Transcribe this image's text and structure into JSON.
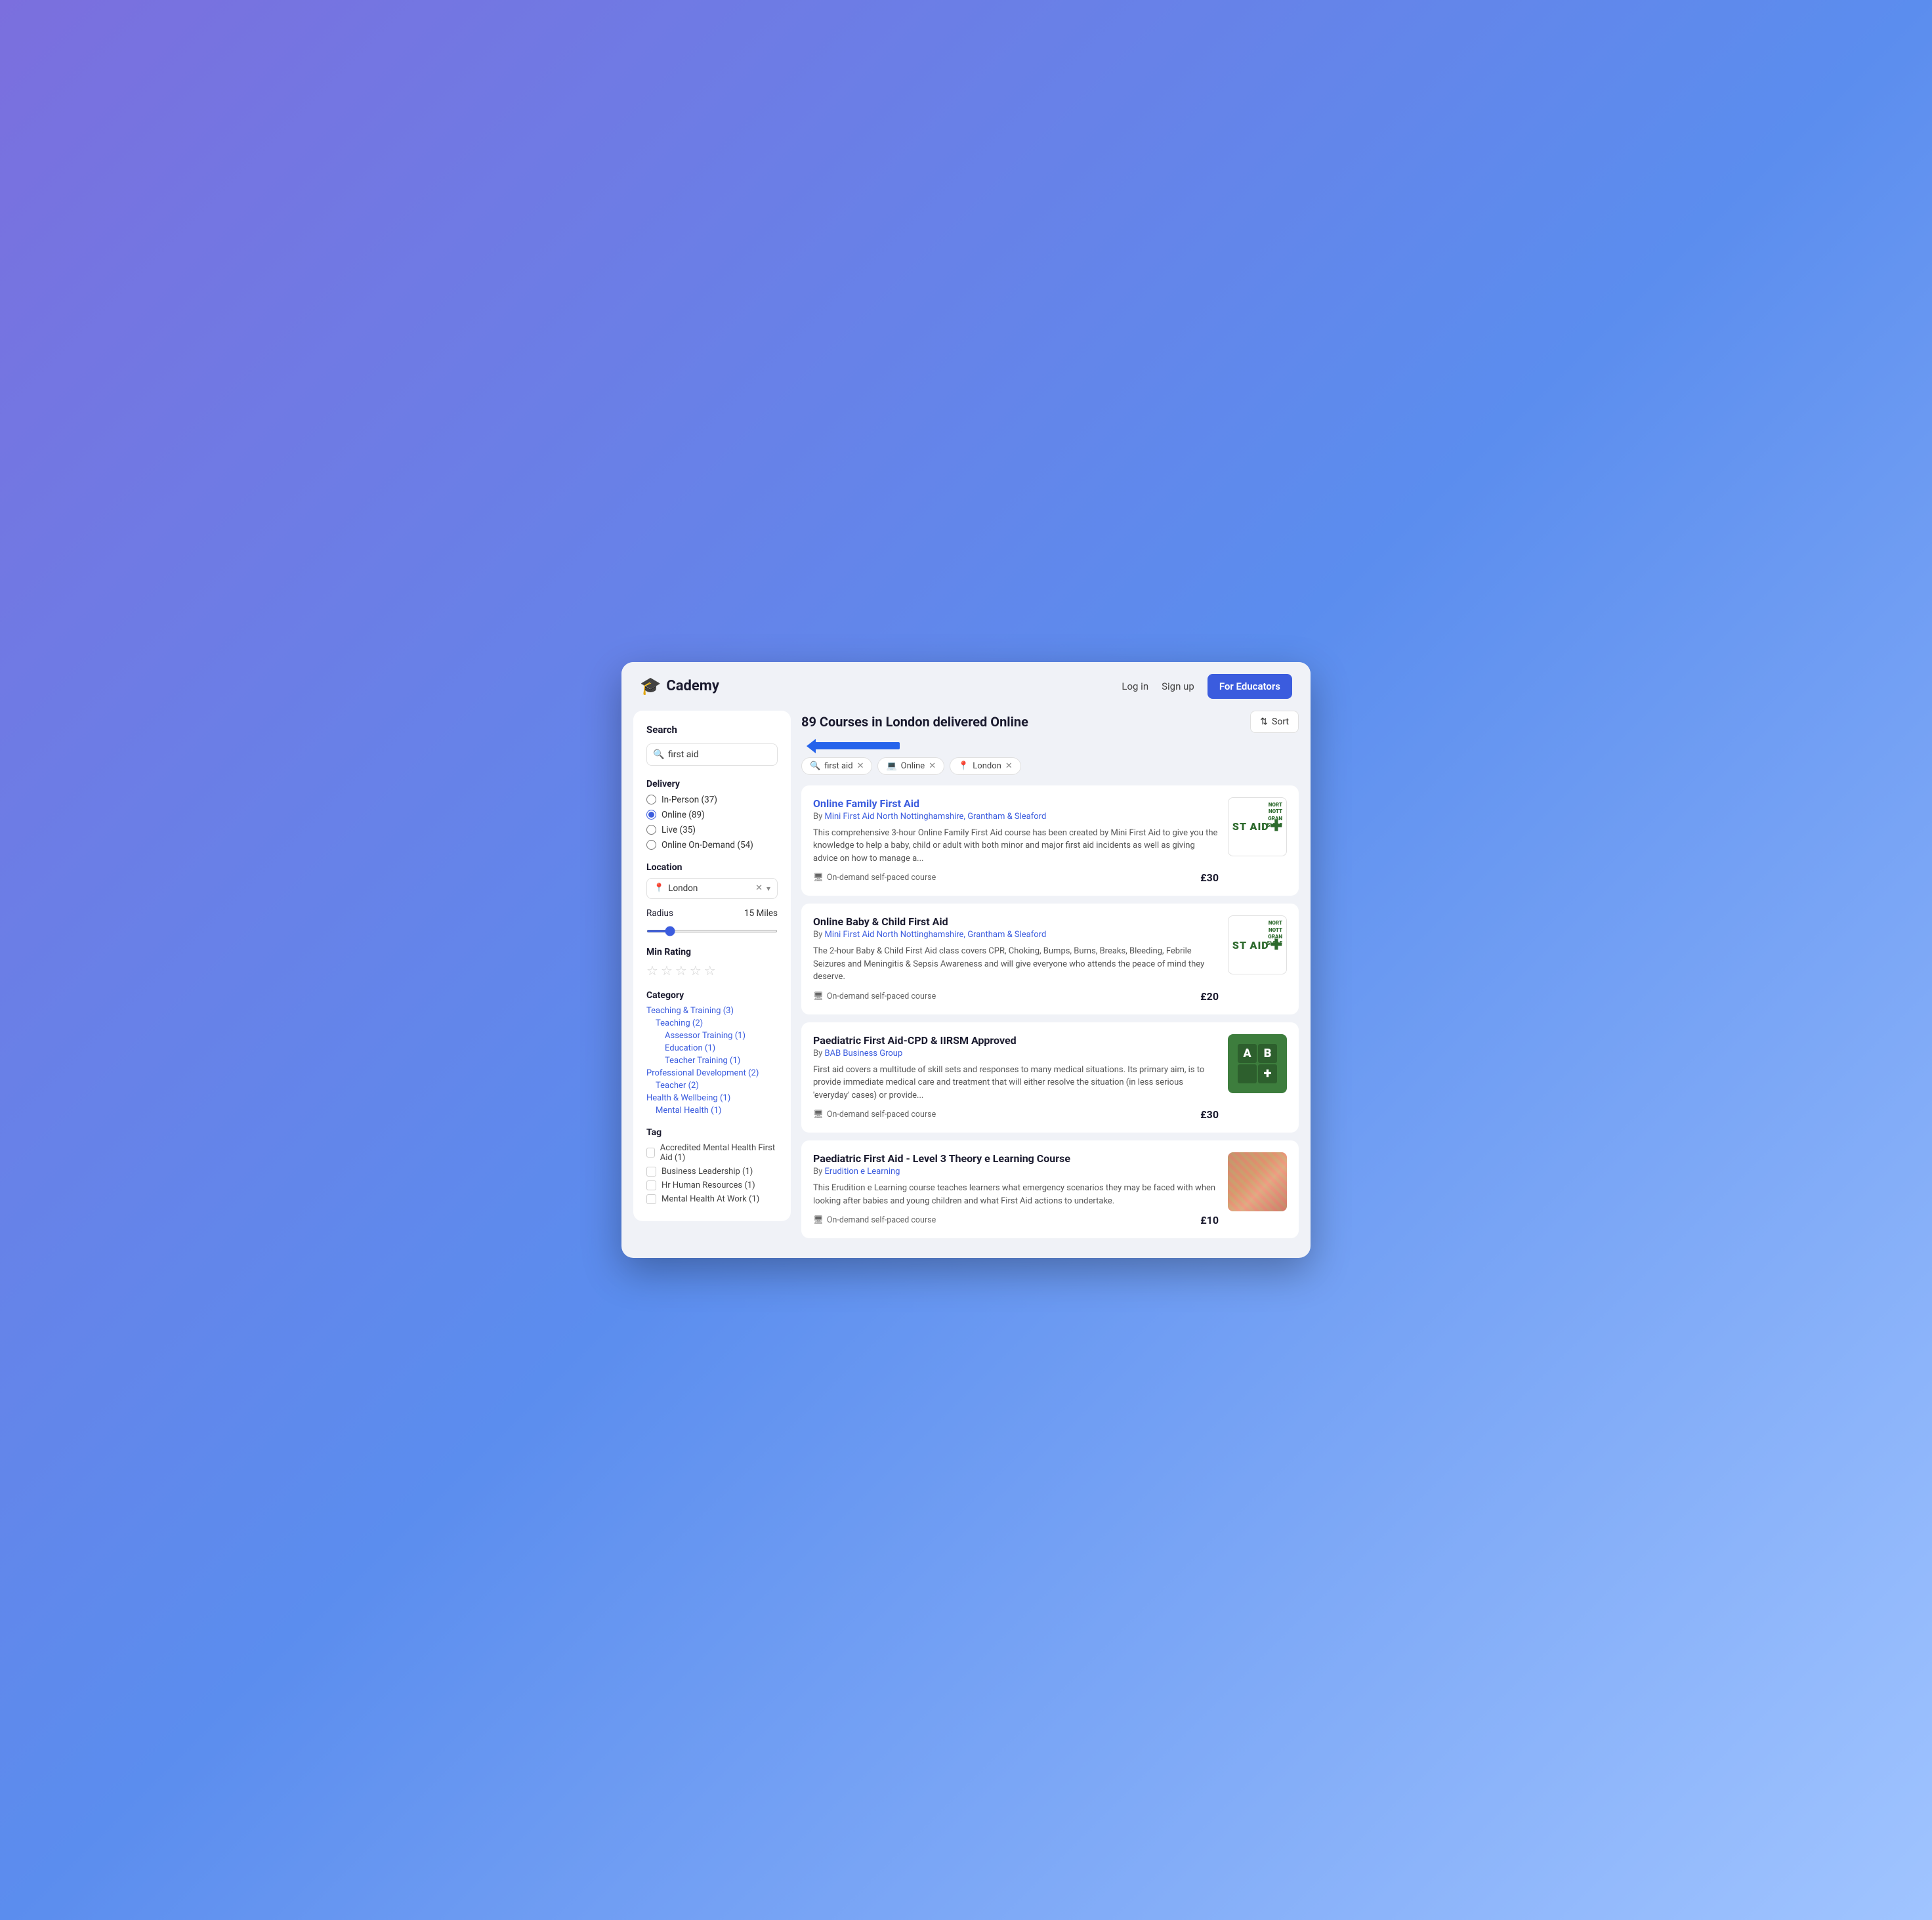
{
  "app": {
    "name": "Cademy",
    "logo_icon": "🎓"
  },
  "header": {
    "login_label": "Log in",
    "signup_label": "Sign up",
    "for_educators_label": "For Educators"
  },
  "sidebar": {
    "search_section_title": "Search",
    "search_placeholder": "first aid",
    "search_value": "first aid",
    "delivery_label": "Delivery",
    "delivery_options": [
      {
        "label": "In-Person (37)",
        "value": "in-person",
        "checked": false
      },
      {
        "label": "Online (89)",
        "value": "online",
        "checked": true
      },
      {
        "label": "Live (35)",
        "value": "live",
        "checked": false
      },
      {
        "label": "Online On-Demand (54)",
        "value": "on-demand",
        "checked": false
      }
    ],
    "location_label": "Location",
    "location_value": "London",
    "radius_label": "Radius",
    "radius_value": "15 Miles",
    "min_rating_label": "Min Rating",
    "category_label": "Category",
    "categories": [
      {
        "label": "Teaching & Training (3)",
        "level": 0
      },
      {
        "label": "Teaching (2)",
        "level": 1
      },
      {
        "label": "Assessor Training (1)",
        "level": 2
      },
      {
        "label": "Education (1)",
        "level": 2
      },
      {
        "label": "Teacher Training (1)",
        "level": 2
      },
      {
        "label": "Professional Development (2)",
        "level": 0
      },
      {
        "label": "Teacher (2)",
        "level": 1
      },
      {
        "label": "Health & Wellbeing (1)",
        "level": 0
      },
      {
        "label": "Mental Health (1)",
        "level": 1
      }
    ],
    "tag_label": "Tag",
    "tags": [
      {
        "label": "Accredited Mental Health First Aid (1)"
      },
      {
        "label": "Business Leadership (1)"
      },
      {
        "label": "Hr Human Resources (1)"
      },
      {
        "label": "Mental Health At Work (1)"
      }
    ]
  },
  "results": {
    "title": "89 Courses in London delivered Online",
    "sort_label": "Sort",
    "active_filters": [
      {
        "icon": "🔍",
        "label": "first aid"
      },
      {
        "icon": "💻",
        "label": "Online"
      },
      {
        "icon": "📍",
        "label": "London"
      }
    ],
    "courses": [
      {
        "id": "1",
        "title": "Online Family First Aid",
        "provider": "Mini First Aid North Nottinghamshire, Grantham & Sleaford",
        "description": "This comprehensive 3-hour Online Family First Aid course has been created by Mini First Aid to give you the knowledge to help a baby, child or adult with both minor and major first aid incidents as well as giving advice on how to manage a...",
        "delivery": "On-demand self-paced course",
        "price": "£30",
        "thumb_type": "st-aid",
        "thumb_side": "NORT\nNOTT\nGRAN\nSLEAF"
      },
      {
        "id": "2",
        "title": "Online Baby & Child First Aid",
        "provider": "Mini First Aid North Nottinghamshire, Grantham & Sleaford",
        "description": "The 2-hour Baby & Child First Aid class covers CPR, Choking, Bumps, Burns, Breaks, Bleeding, Febrile Seizures and Meningitis & Sepsis Awareness and will give everyone who attends the peace of mind they deserve.",
        "delivery": "On-demand self-paced course",
        "price": "£20",
        "thumb_type": "st-aid",
        "thumb_side": "NORT\nNOTT\nGRAN\nSLEAF"
      },
      {
        "id": "3",
        "title": "Paediatric First Aid-CPD & IIRSM Approved",
        "provider": "BAB Business Group",
        "description": "First aid covers a multitude of skill sets and responses to many medical situations. Its primary aim, is to provide immediate medical care and treatment that will either resolve the situation (in less serious 'everyday' cases) or provide...",
        "delivery": "On-demand self-paced course",
        "price": "£30",
        "thumb_type": "ab"
      },
      {
        "id": "4",
        "title": "Paediatric First Aid - Level 3 Theory e Learning Course",
        "provider": "Erudition e Learning",
        "description": "This Erudition e Learning course teaches learners what emergency scenarios they may be faced with when looking after babies and young children and what First Aid actions to undertake.",
        "delivery": "On-demand self-paced course",
        "price": "£10",
        "thumb_type": "paed"
      }
    ]
  }
}
